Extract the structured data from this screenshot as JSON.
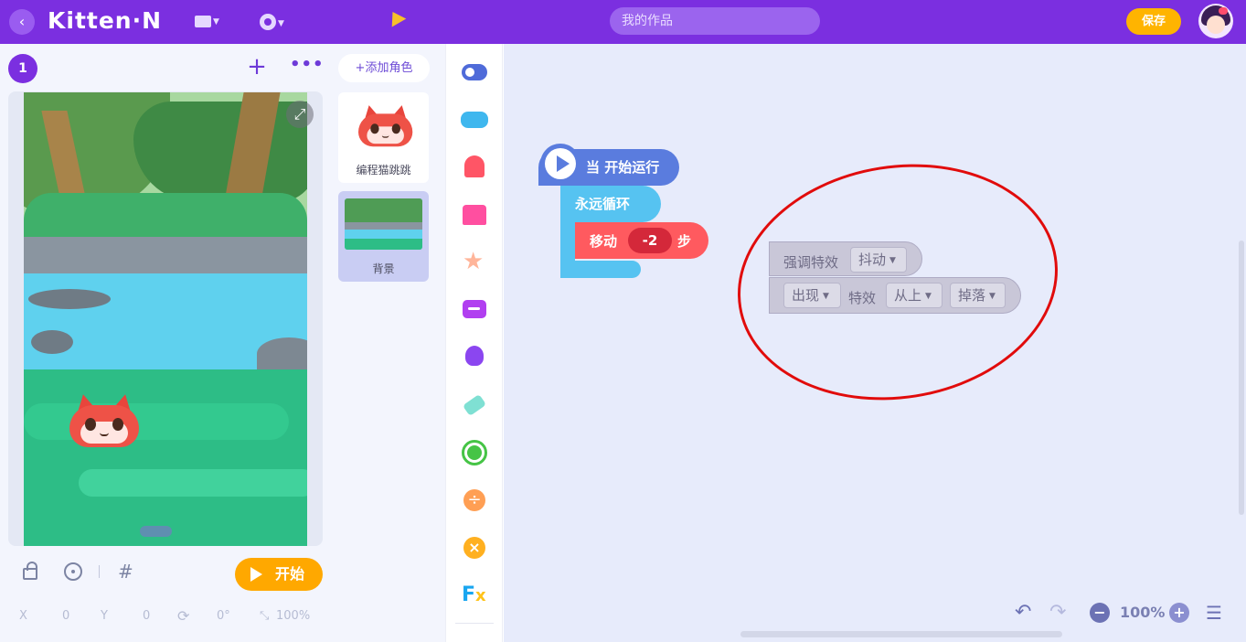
{
  "header": {
    "back_icon": "‹",
    "logo": "Kitten·N",
    "search_placeholder": "我的作品",
    "save_label": "保存"
  },
  "stage_panel": {
    "scene_number": "1",
    "add_scene_icon": "+",
    "more_icon": "•••",
    "add_role_label": "+添加角色",
    "roles": [
      {
        "name": "编程猫跳跳"
      },
      {
        "name": "背景"
      }
    ],
    "start_label": "开始",
    "coords": {
      "x_label": "X",
      "x_value": "0",
      "y_label": "Y",
      "y_value": "0",
      "rotation": "0°",
      "scale": "100%"
    }
  },
  "workspace": {
    "hat_label": "当 开始运行",
    "loop_label": "永远循环",
    "move_label": "移动",
    "move_value": "-2",
    "move_unit": "步",
    "ghost_block_1": {
      "label": "强调特效",
      "dropdown": "抖动"
    },
    "ghost_block_2": {
      "dropdown_1": "出现",
      "label": "特效",
      "dropdown_2": "从上",
      "dropdown_3": "掉落"
    },
    "zoom": "100%"
  },
  "colors": {
    "brand_purple": "#7b2fe0",
    "save_orange": "#ffb400",
    "annotation_red": "#e10b0b"
  }
}
